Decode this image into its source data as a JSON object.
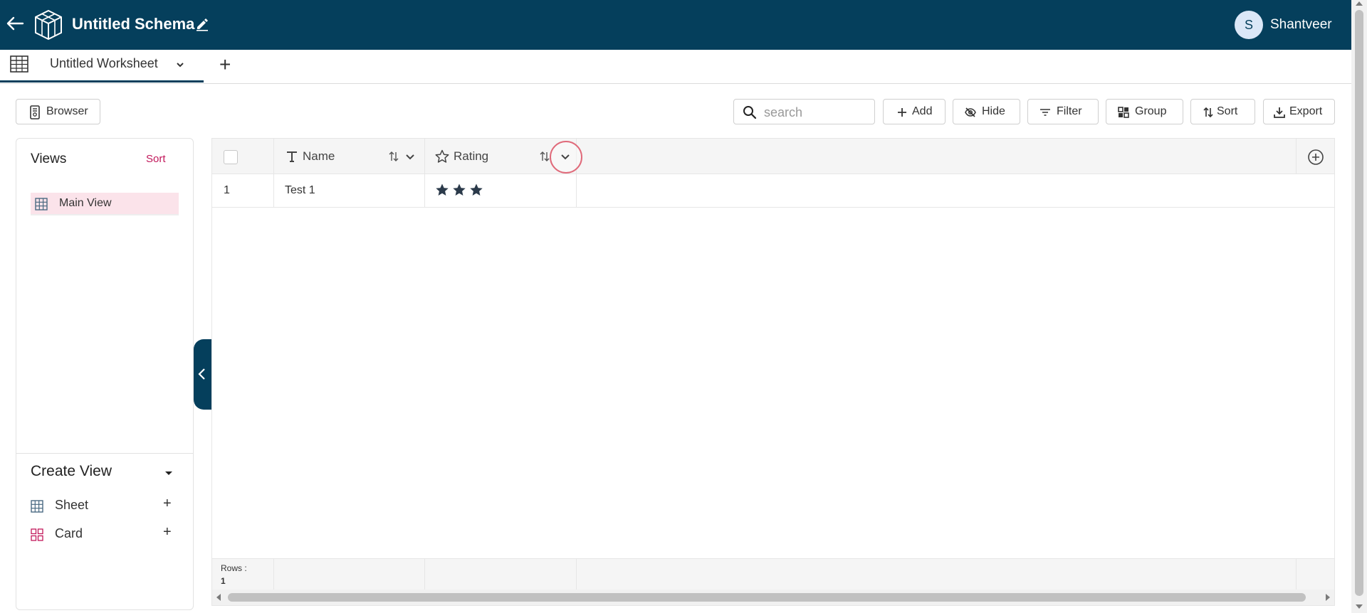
{
  "header": {
    "schema_title": "Untitled Schema",
    "user_initial": "S",
    "user_name": "Shantveer",
    "brand_color": "#053f5c"
  },
  "tabs": {
    "active_label": "Untitled Worksheet",
    "add_label": "+"
  },
  "toolbar": {
    "browser_label": "Browser",
    "search_placeholder": "search",
    "search_value": "",
    "add_label": "Add",
    "hide_label": "Hide",
    "filter_label": "Filter",
    "group_label": "Group",
    "sort_label": "Sort",
    "export_label": "Export"
  },
  "views": {
    "title": "Views",
    "sort_label": "Sort",
    "items": [
      {
        "label": "Main View",
        "icon": "grid-icon",
        "selected": true
      }
    ],
    "accent_color": "#c2185b"
  },
  "create_view": {
    "title": "Create View",
    "items": [
      {
        "label": "Sheet",
        "icon": "grid-icon",
        "plus": "+"
      },
      {
        "label": "Card",
        "icon": "card-grid-icon",
        "plus": "+"
      }
    ]
  },
  "grid": {
    "columns": [
      {
        "label": "Name",
        "type_icon": "text-type-icon"
      },
      {
        "label": "Rating",
        "type_icon": "star-outline-icon"
      }
    ],
    "rows": [
      {
        "num": "1",
        "name": "Test 1",
        "rating": 3
      }
    ],
    "footer": {
      "rows_label": "Rows :",
      "rows_count": "1"
    }
  }
}
